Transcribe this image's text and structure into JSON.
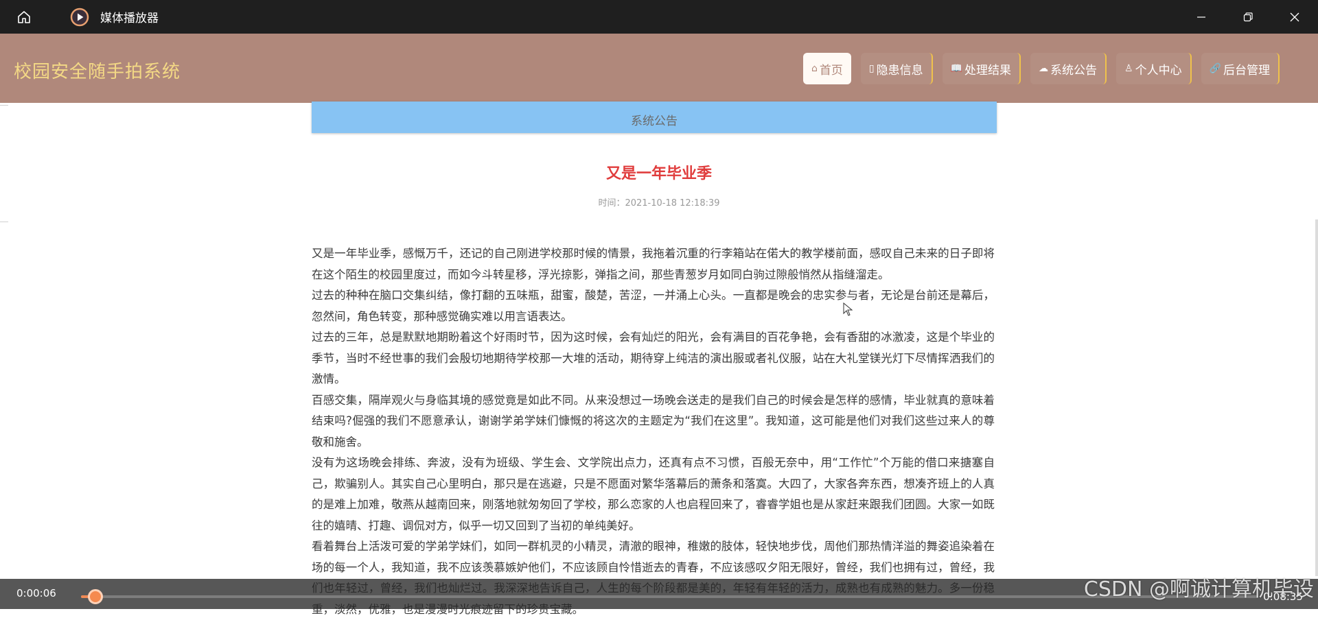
{
  "window": {
    "title": "媒体播放器"
  },
  "site": {
    "title": "校园安全随手拍系统",
    "nav": [
      {
        "label": "首页",
        "icon": "home-icon",
        "active": true
      },
      {
        "label": "隐患信息",
        "icon": "info-icon",
        "active": false
      },
      {
        "label": "处理结果",
        "icon": "book-icon",
        "active": false
      },
      {
        "label": "系统公告",
        "icon": "chat-icon",
        "active": false
      },
      {
        "label": "个人中心",
        "icon": "user-icon",
        "active": false
      },
      {
        "label": "后台管理",
        "icon": "link-icon",
        "active": false
      }
    ]
  },
  "banner": {
    "text": "系统公告"
  },
  "article": {
    "title": "又是一年毕业季",
    "time": "时间：2021-10-18 12:18:39",
    "paragraphs": [
      "又是一年毕业季，感慨万千，还记的自己刚进学校那时候的情景，我拖着沉重的行李箱站在偌大的教学楼前面，感叹自己未来的日子即将在这个陌生的校园里度过，而如今斗转星移，浮光掠影，弹指之间，那些青葱岁月如同白驹过隙般悄然从指缝溜走。",
      "过去的种种在脑口交集纠结，像打翻的五味瓶，甜蜜，酸楚，苦涩，一并涌上心头。一直都是晚会的忠实参与者，无论是台前还是幕后，忽然间，角色转变，那种感觉确实难以用言语表达。",
      "过去的三年，总是默默地期盼着这个好雨时节，因为这时候，会有灿烂的阳光，会有满目的百花争艳，会有香甜的冰激凌，这是个毕业的季节，当时不经世事的我们会殷切地期待学校那一大堆的活动，期待穿上纯洁的演出服或者礼仪服，站在大礼堂镁光灯下尽情挥洒我们的激情。",
      "百感交集，隔岸观火与身临其境的感觉竟是如此不同。从来没想过一场晚会送走的是我们自己的时候会是怎样的感情，毕业就真的意味着结束吗?倔强的我们不愿意承认，谢谢学弟学妹们慷慨的将这次的主题定为“我们在这里”。我知道，这可能是他们对我们这些过来人的尊敬和施舍。",
      "没有为这场晚会排练、奔波，没有为班级、学生会、文学院出点力，还真有点不习惯，百般无奈中，用“工作忙”个万能的借口来搪塞自己，欺骗别人。其实自己心里明白，那只是在逃避，只是不愿面对繁华落幕后的萧条和落寞。大四了，大家各奔东西，想凑齐班上的人真的是难上加难，敬燕从越南回来，刚落地就匆匆回了学校，那么恋家的人也启程回来了，睿睿学姐也是从家赶来跟我们团圆。大家一如既往的嬉晴、打趣、调侃对方，似乎一切又回到了当初的单纯美好。",
      "看着舞台上活泼可爱的学弟学妹们，如同一群机灵的小精灵，清澈的眼神，稚嫩的肢体，轻快地步伐，周他们那热情洋溢的舞姿追染着在场的每一个人，我知道，我不应该羡慕嫉妒他们，不应该顾自怜惜逝去的青春，不应该感叹夕阳无限好，曾经，我们也拥有过，曾经，我们也年轻过，曾经，我们也灿烂过。我深深地告诉自己，人生的每个阶段都是美的，年轻有年轻的活力，成熟也有成熟的魅力。多一份稳重，淡然，优雅，也是漫漫时光痕迹留下的珍贵宝藏。"
    ]
  },
  "player": {
    "current_time": "0:00:06",
    "total_time": "0:08:35",
    "progress": 0.012
  },
  "watermark": "CSDN @啊诚计算机毕设",
  "colors": {
    "header_bg": "#b0887b",
    "site_title": "#f4d985",
    "nav_border": "#f0c24b",
    "article_title": "#e03c3c",
    "banner_bg": "#87c3f3",
    "progress": "#f08a55"
  }
}
